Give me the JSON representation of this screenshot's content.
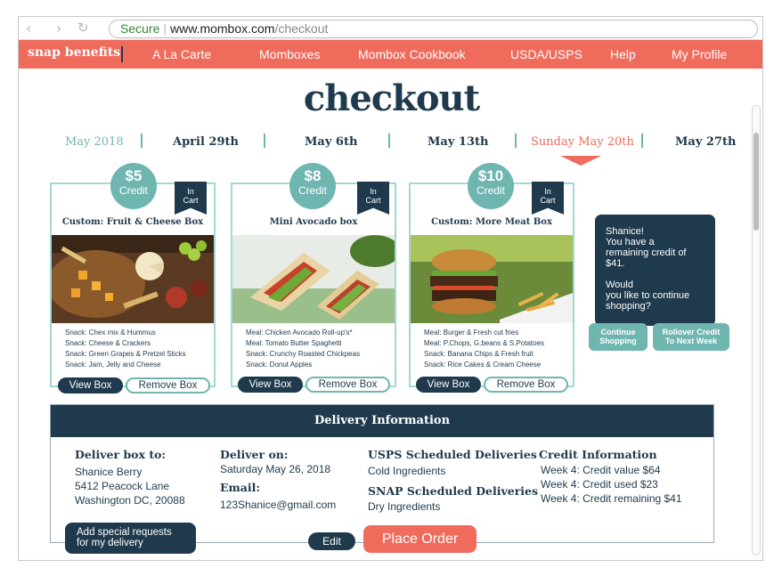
{
  "browser": {
    "url_secure": "Secure",
    "url_domain": "www.mombox.com",
    "url_path": "/checkout"
  },
  "nav": {
    "brand": "snap benefits",
    "items": [
      "A La Carte",
      "Momboxes",
      "Mombox Cookbook",
      "USDA/USPS",
      "Help",
      "My Profile"
    ]
  },
  "page_title": "checkout",
  "dates": {
    "month": "May 2018",
    "weeks": [
      "April 29th",
      "May 6th",
      "May 13th",
      "Sunday May 20th",
      "May 27th"
    ],
    "active_index": 3
  },
  "cards": [
    {
      "credit_amount": "$5",
      "credit_label": "Credit",
      "badge_line1": "In",
      "badge_line2": "Cart",
      "title": "Custom: Fruit & Cheese Box",
      "items": [
        "Snack: Chex mix & Hummus",
        "Snack: Cheese & Crackers",
        "Snack: Green Grapes & Pretzel Sticks",
        "Snack: Jam, Jelly and Cheese"
      ],
      "view_label": "View Box",
      "remove_label": "Remove Box"
    },
    {
      "credit_amount": "$8",
      "credit_label": "Credit",
      "badge_line1": "In",
      "badge_line2": "Cart",
      "title": "Mini Avocado box",
      "items": [
        "Meal: Chicken Avocado Roll-up's*",
        "Meal: Tomato Butter Spaghetti",
        "Snack: Crunchy Roasted Chickpeas",
        "Snack: Donut Apples"
      ],
      "view_label": "View Box",
      "remove_label": "Remove Box"
    },
    {
      "credit_amount": "$10",
      "credit_label": "Credit",
      "badge_line1": "In",
      "badge_line2": "Cart",
      "title": "Custom: More Meat Box",
      "items": [
        "Meal: Burger & Fresh cut fries",
        "Meal: P.Chops, G.beans & S.Potatoes",
        "Snack: Banana Chips & Fresh fruit",
        "Snack: Rice Cakes & Cream Cheese"
      ],
      "view_label": "View Box",
      "remove_label": "Remove Box"
    }
  ],
  "promo": {
    "line1": "Shanice!",
    "line2": "You have a",
    "line3": "remaining credit of",
    "line4": "$41.",
    "line5": "Would",
    "line6": "you like to continue",
    "line7": "shopping?",
    "continue_line1": "Continue",
    "continue_line2": "Shopping",
    "rollover_line1": "Rollover Credit",
    "rollover_line2": "To Next Week"
  },
  "delivery": {
    "heading": "Delivery Information",
    "deliver_to_label": "Deliver box to:",
    "name": "Shanice Berry",
    "street": "5412 Peacock Lane",
    "city": "Washington DC, 20088",
    "deliver_on_label": "Deliver on:",
    "deliver_on": "Saturday May 26, 2018",
    "email_label": "Email:",
    "email": "123Shanice@gmail.com",
    "usps_label": "USPS Scheduled Deliveries",
    "usps_value": "Cold Ingredients",
    "snap_label": "SNAP Scheduled Deliveries",
    "snap_value": "Dry Ingredients",
    "credit_label": "Credit Information",
    "credit_lines": [
      "Week 4: Credit value $64",
      "Week 4: Credit used $23",
      "Week 4: Credit remaining $41"
    ]
  },
  "actions": {
    "special_line1": "Add special requests",
    "special_line2": "for my delivery",
    "edit": "Edit",
    "place_order": "Place Order"
  },
  "colors": {
    "brand_coral": "#ef6b5c",
    "navy": "#1f3a4d",
    "teal": "#6fb5b0",
    "teal_light": "#9fd9d4"
  }
}
